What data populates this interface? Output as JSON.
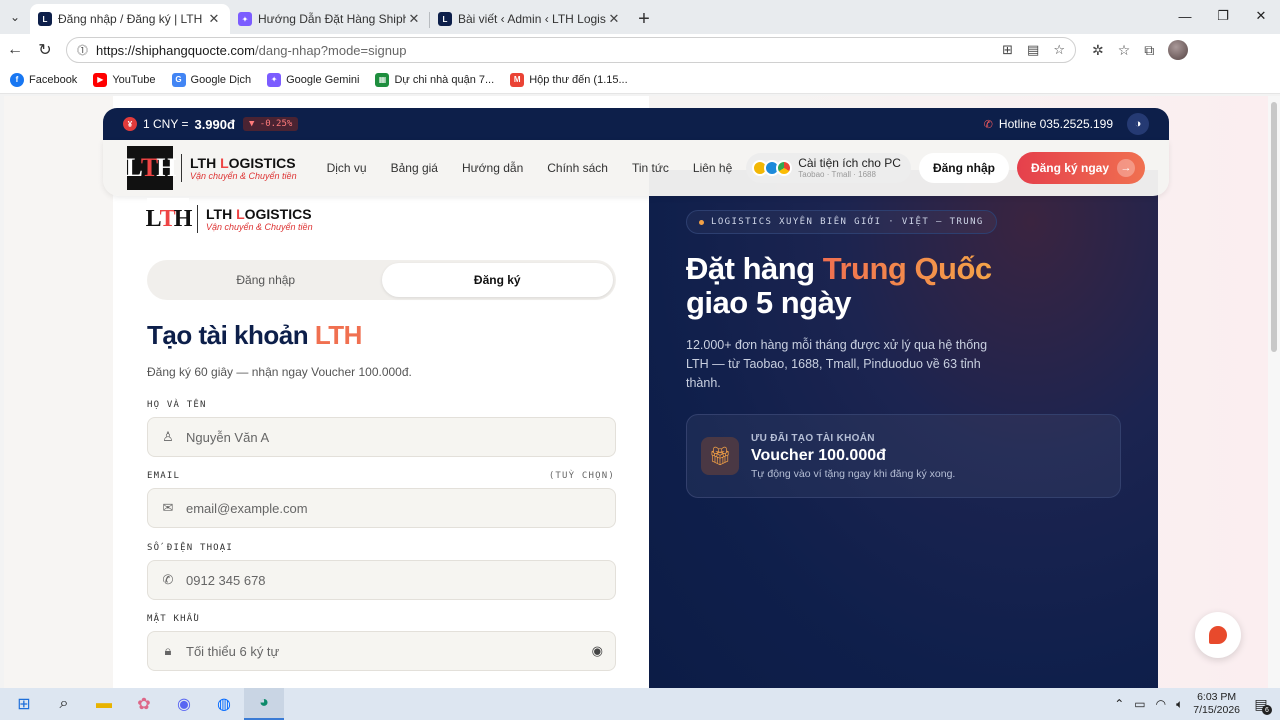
{
  "browser": {
    "tabs": [
      {
        "title": "Đăng nhập / Đăng ký | LTH Logistics",
        "active": true,
        "favicon_color": "#0d1f4a"
      },
      {
        "title": "Hướng Dẫn Đặt Hàng Shiphangqu...",
        "active": false,
        "favicon_color": "#7b5cff"
      },
      {
        "title": "Bài viết ‹ Admin ‹ LTH Logistics",
        "active": false,
        "favicon_color": "#0d1f4a"
      }
    ],
    "url_host": "https://shiphangquocte.com",
    "url_path": "/dang-nhap?mode=signup",
    "bookmarks": [
      {
        "label": "Facebook",
        "icon": "facebook-icon",
        "color": "#1877f2"
      },
      {
        "label": "YouTube",
        "icon": "youtube-icon",
        "color": "#ff0000"
      },
      {
        "label": "Google Dịch",
        "icon": "translate-icon",
        "color": "#4285f4"
      },
      {
        "label": "Google Gemini",
        "icon": "gemini-icon",
        "color": "#7b5cff"
      },
      {
        "label": "Dự chi nhà quận 7...",
        "icon": "sheets-icon",
        "color": "#1e8e3e"
      },
      {
        "label": "Hộp thư đến (1.15...",
        "icon": "gmail-icon",
        "color": "#ea4335"
      }
    ]
  },
  "topbar": {
    "cny_label": "1 CNY =",
    "cny_rate": "3.990đ",
    "cny_change": "▼ -0.25%",
    "hotline": "Hotline 035.2525.199"
  },
  "header": {
    "brand_prefix": "LTH ",
    "brand_l": "L",
    "brand_rest": "OGISTICS",
    "tagline": "Vận chuyển & Chuyển tiền",
    "nav": [
      "Dịch vụ",
      "Bảng giá",
      "Hướng dẫn",
      "Chính sách",
      "Tin tức",
      "Liên hệ"
    ],
    "ext_title": "Cài tiện ích cho PC",
    "ext_sub": "Taobao · Tmall · 1688",
    "login_btn": "Đăng nhập",
    "signup_btn": "Đăng ký ngay"
  },
  "form": {
    "tab_login": "Đăng nhập",
    "tab_signup": "Đăng ký",
    "title": "Tạo tài khoản ",
    "title_accent": "LTH",
    "subtitle": "Đăng ký 60 giây — nhận ngay Voucher 100.000đ.",
    "name_label": "HỌ VÀ TÊN",
    "name_placeholder": "Nguyễn Văn A",
    "email_label": "EMAIL",
    "email_optional": "(TUỲ CHỌN)",
    "email_placeholder": "email@example.com",
    "phone_label": "SỐ ĐIỆN THOẠI",
    "phone_placeholder": "0912 345 678",
    "password_label": "MẬT KHẨU",
    "password_placeholder": "Tối thiểu 6 ký tự"
  },
  "hero": {
    "pill": "LOGISTICS XUYÊN BIÊN GIỚI · VIỆT – TRUNG",
    "title_1": "Đặt hàng ",
    "title_accent": "Trung Quốc",
    "title_2": "giao 5 ngày",
    "description": "12.000+ đơn hàng mỗi tháng được xử lý qua hệ thống LTH — từ Taobao, 1688, Tmall, Pinduoduo về 63 tỉnh thành.",
    "promo_kicker": "ƯU ĐÃI TẠO TÀI KHOẢN",
    "promo_value": "Voucher 100.000đ",
    "promo_sub": "Tự động vào ví tặng ngay khi đăng ký xong."
  },
  "taskbar": {
    "time": "6:03 PM",
    "date": "7/15/2026",
    "notif_count": "6"
  }
}
